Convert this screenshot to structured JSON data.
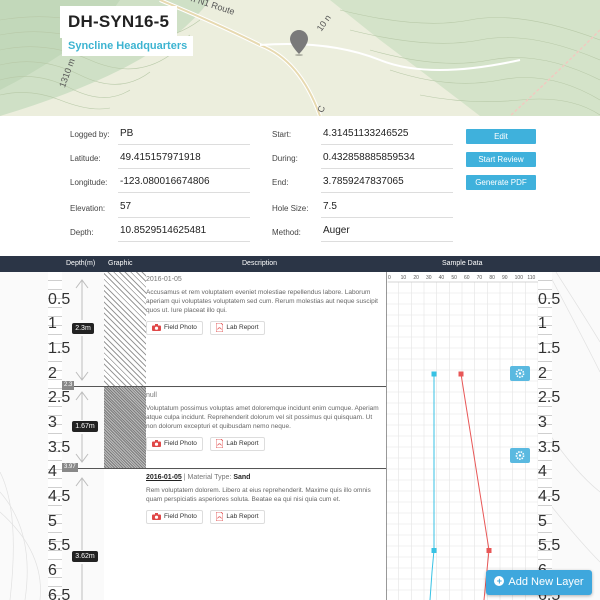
{
  "map": {
    "title": "DH-SYN16-5",
    "subtitle": "Syncline Headquarters",
    "road_label": "n N1 Route",
    "label_10n": "10 n",
    "label_1310": "1310 m",
    "label_c": "C"
  },
  "info": {
    "logged_by_label": "Logged by:",
    "logged_by": "PB",
    "latitude_label": "Latitude:",
    "latitude": "49.415157971918",
    "longitude_label": "Longitude:",
    "longitude": "-123.080016674806",
    "elevation_label": "Elevation:",
    "elevation": "57",
    "depth_label": "Depth:",
    "depth": "10.8529514625481",
    "start_label": "Start:",
    "start": "4.31451133246525",
    "during_label": "During:",
    "during": "0.432858885859534",
    "end_label": "End:",
    "end": "3.7859247837065",
    "hole_size_label": "Hole Size:",
    "hole_size": "7.5",
    "method_label": "Method:",
    "method": "Auger"
  },
  "buttons": {
    "edit": "Edit",
    "start_review": "Start Review",
    "generate_pdf": "Generate PDF",
    "add_layer": "Add New Layer"
  },
  "columns": {
    "depth": "Depth(m)",
    "graphic": "Graphic",
    "description": "Description",
    "sample": "Sample Data"
  },
  "chart_scale": [
    "0",
    "10",
    "20",
    "30",
    "40",
    "50",
    "60",
    "70",
    "80",
    "90",
    "100",
    "110"
  ],
  "layers": [
    {
      "depth": "2.3m",
      "marker": "2.3",
      "date": "2016-01-05",
      "text": "Accusamus et rem voluptatem eveniet molestiae repellendus labore. Laborum aperiam qui voluptates voluptatem sed cum. Rerum molestias aut neque suscipit quos ut. Iure placeat illo qui.",
      "photo": "Field Photo",
      "report": "Lab Report"
    },
    {
      "depth": "1.67m",
      "marker": "3.97",
      "date": "null",
      "text": "Voluptatum possimus voluptas amet doloremque incidunt enim cumque. Aperiam atque culpa incidunt. Reprehenderit dolorum vel sit possimus qui quisquam. Ut non dolorum excepturi et quibusdam nemo neque.",
      "photo": "Field Photo",
      "report": "Lab Report"
    },
    {
      "depth": "3.62m",
      "date": "2016-01-05",
      "material_label": "| Material Type:",
      "material": "Sand",
      "text": "Rem voluptatem dolorem. Libero at eius reprehenderit. Maxime quis illo omnis quam perspiciatis asperiores soluta. Beatae ea qui nisi quia cum et.",
      "photo": "Field Photo",
      "report": "Lab Report"
    }
  ],
  "ruler_ticks": [
    "0.5",
    "1",
    "1.5",
    "2",
    "2.5",
    "3",
    "3.5",
    "4",
    "4.5",
    "5",
    "5.5",
    "6",
    "6.5"
  ],
  "colors": {
    "accent": "#3fb1dc",
    "header": "#2b3546",
    "series_blue": "#37c2e4",
    "series_red": "#e85757"
  }
}
